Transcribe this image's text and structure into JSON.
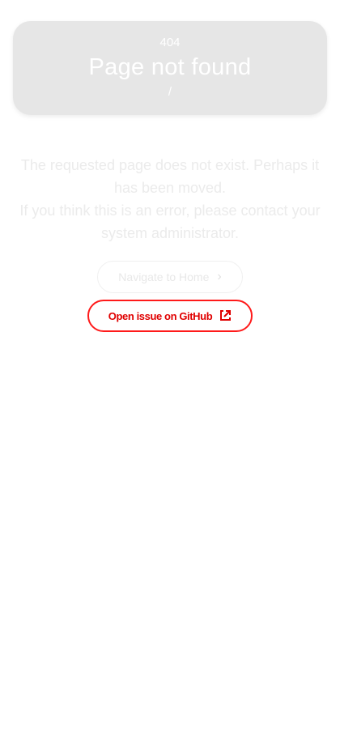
{
  "header": {
    "code": "404",
    "title": "Page not found",
    "path": "/"
  },
  "message": {
    "line1": "The requested page does not exist. Perhaps it has been moved.",
    "line2": "If you think this is an error, please contact your system administrator."
  },
  "actions": {
    "home_label": "Navigate to Home",
    "home_icon": "chevron-right-icon",
    "github_label": "Open issue on GitHub",
    "github_icon": "external-link-icon"
  },
  "colors": {
    "hero_background": "#e6e6e6",
    "github_accent": "#e00000"
  }
}
